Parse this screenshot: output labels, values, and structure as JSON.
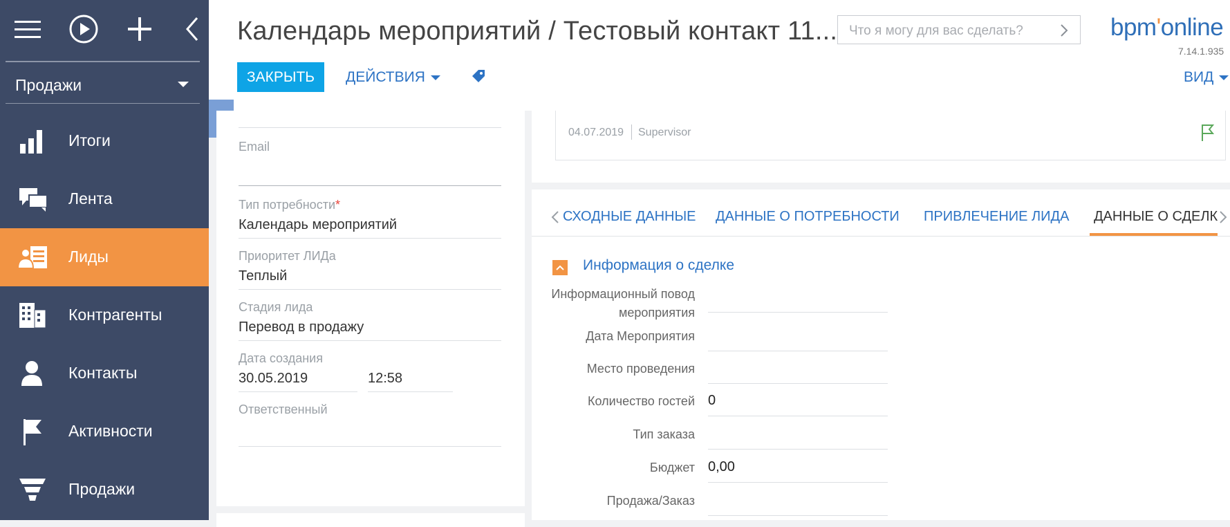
{
  "sidebar": {
    "workplace": "Продажи",
    "items": [
      {
        "label": "Итоги",
        "icon": "bar-chart-icon",
        "active": false
      },
      {
        "label": "Лента",
        "icon": "chat-bubbles-icon",
        "active": false
      },
      {
        "label": "Лиды",
        "icon": "leads-icon",
        "active": true
      },
      {
        "label": "Контрагенты",
        "icon": "building-icon",
        "active": false
      },
      {
        "label": "Контакты",
        "icon": "person-icon",
        "active": false
      },
      {
        "label": "Активности",
        "icon": "flag-icon",
        "active": false
      },
      {
        "label": "Продажи",
        "icon": "funnel-icon",
        "active": false
      }
    ]
  },
  "header": {
    "title": "Календарь мероприятий / Тестовый контакт 11...",
    "search_placeholder": "Что я могу для вас сделать?",
    "logo_text": "bpm'online",
    "version": "7.14.1.935",
    "close_label": "ЗАКРЫТЬ",
    "actions_label": "ДЕЙСТВИЯ",
    "view_label": "ВИД"
  },
  "left_fields": {
    "email_label": "Email",
    "email_value": "",
    "need_type_label": "Тип потребности",
    "need_type_required": "*",
    "need_type_value": "Календарь мероприятий",
    "priority_label": "Приоритет ЛИДа",
    "priority_value": "Теплый",
    "stage_label": "Стадия лида",
    "stage_value": "Перевод в продажу",
    "created_label": "Дата создания",
    "created_date": "30.05.2019",
    "created_time": "12:58",
    "owner_label": "Ответственный",
    "owner_value": ""
  },
  "activity": {
    "date": "04.07.2019",
    "user": "Supervisor"
  },
  "tabs": [
    {
      "label": "СХОДНЫЕ ДАННЫЕ",
      "active": false
    },
    {
      "label": "ДАННЫЕ О ПОТРЕБНОСТИ",
      "active": false
    },
    {
      "label": "ПРИВЛЕЧЕНИЕ ЛИДА",
      "active": false
    },
    {
      "label": "ДАННЫЕ О СДЕЛКЕ",
      "active": true
    }
  ],
  "deal_group": {
    "title": "Информация о сделке",
    "fields": [
      {
        "label": "Информационный повод мероприятия",
        "value": ""
      },
      {
        "label": "Дата Мероприятия",
        "value": ""
      },
      {
        "label": "Место проведения",
        "value": ""
      },
      {
        "label": "Количество гостей",
        "value": "0"
      },
      {
        "label": "Тип заказа",
        "value": ""
      },
      {
        "label": "Бюджет",
        "value": "0,00"
      },
      {
        "label": "Продажа/Заказ",
        "value": ""
      }
    ]
  },
  "colors": {
    "sidebar": "#3d4a66",
    "accent": "#f29444",
    "primary": "#0ea4e6",
    "link": "#2d73c4"
  }
}
